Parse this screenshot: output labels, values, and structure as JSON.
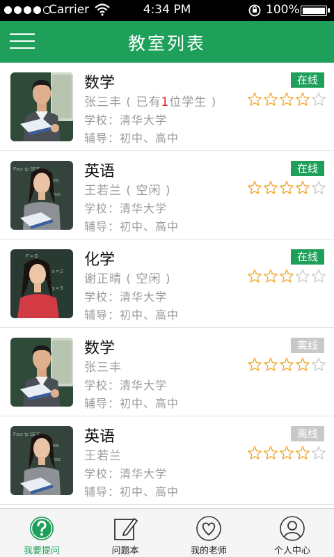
{
  "status_bar": {
    "carrier": "Carrier",
    "time": "4:34 PM",
    "battery": "100%"
  },
  "header": {
    "title": "教室列表"
  },
  "classrooms": [
    {
      "subject": "数学",
      "teacher_pre": "张三丰 ( 已有",
      "teacher_count": "1",
      "teacher_post": "位学生 )",
      "school": "学校：清华大学",
      "tutor": "辅导：初中、高中",
      "status": "在线",
      "online": true,
      "rating": 4,
      "photo": "man"
    },
    {
      "subject": "英语",
      "teacher_pre": "王若兰 ( 空闲 )",
      "teacher_count": "",
      "teacher_post": "",
      "school": "学校：清华大学",
      "tutor": "辅导：初中、高中",
      "status": "在线",
      "online": true,
      "rating": 4,
      "photo": "woman1"
    },
    {
      "subject": "化学",
      "teacher_pre": "谢正晴 ( 空闲 )",
      "teacher_count": "",
      "teacher_post": "",
      "school": "学校：清华大学",
      "tutor": "辅导：初中、高中",
      "status": "在线",
      "online": true,
      "rating": 3,
      "photo": "woman2"
    },
    {
      "subject": "数学",
      "teacher_pre": "张三丰",
      "teacher_count": "",
      "teacher_post": "",
      "school": "学校：清华大学",
      "tutor": "辅导：初中、高中",
      "status": "离线",
      "online": false,
      "rating": 4,
      "photo": "man"
    },
    {
      "subject": "英语",
      "teacher_pre": "王若兰",
      "teacher_count": "",
      "teacher_post": "",
      "school": "学校：清华大学",
      "tutor": "辅导：初中、高中",
      "status": "离线",
      "online": false,
      "rating": 4,
      "photo": "woman1"
    }
  ],
  "tabs": [
    {
      "label": "我要提问",
      "icon": "question-icon",
      "active": true
    },
    {
      "label": "问题本",
      "icon": "notebook-icon",
      "active": false
    },
    {
      "label": "我的老师",
      "icon": "heart-icon",
      "active": false
    },
    {
      "label": "个人中心",
      "icon": "person-icon",
      "active": false
    }
  ],
  "colors": {
    "brand": "#1e9f5a",
    "offline": "#c8c8c8",
    "star": "#f0a830",
    "star_empty": "#cccccc",
    "highlight": "#e02020"
  }
}
